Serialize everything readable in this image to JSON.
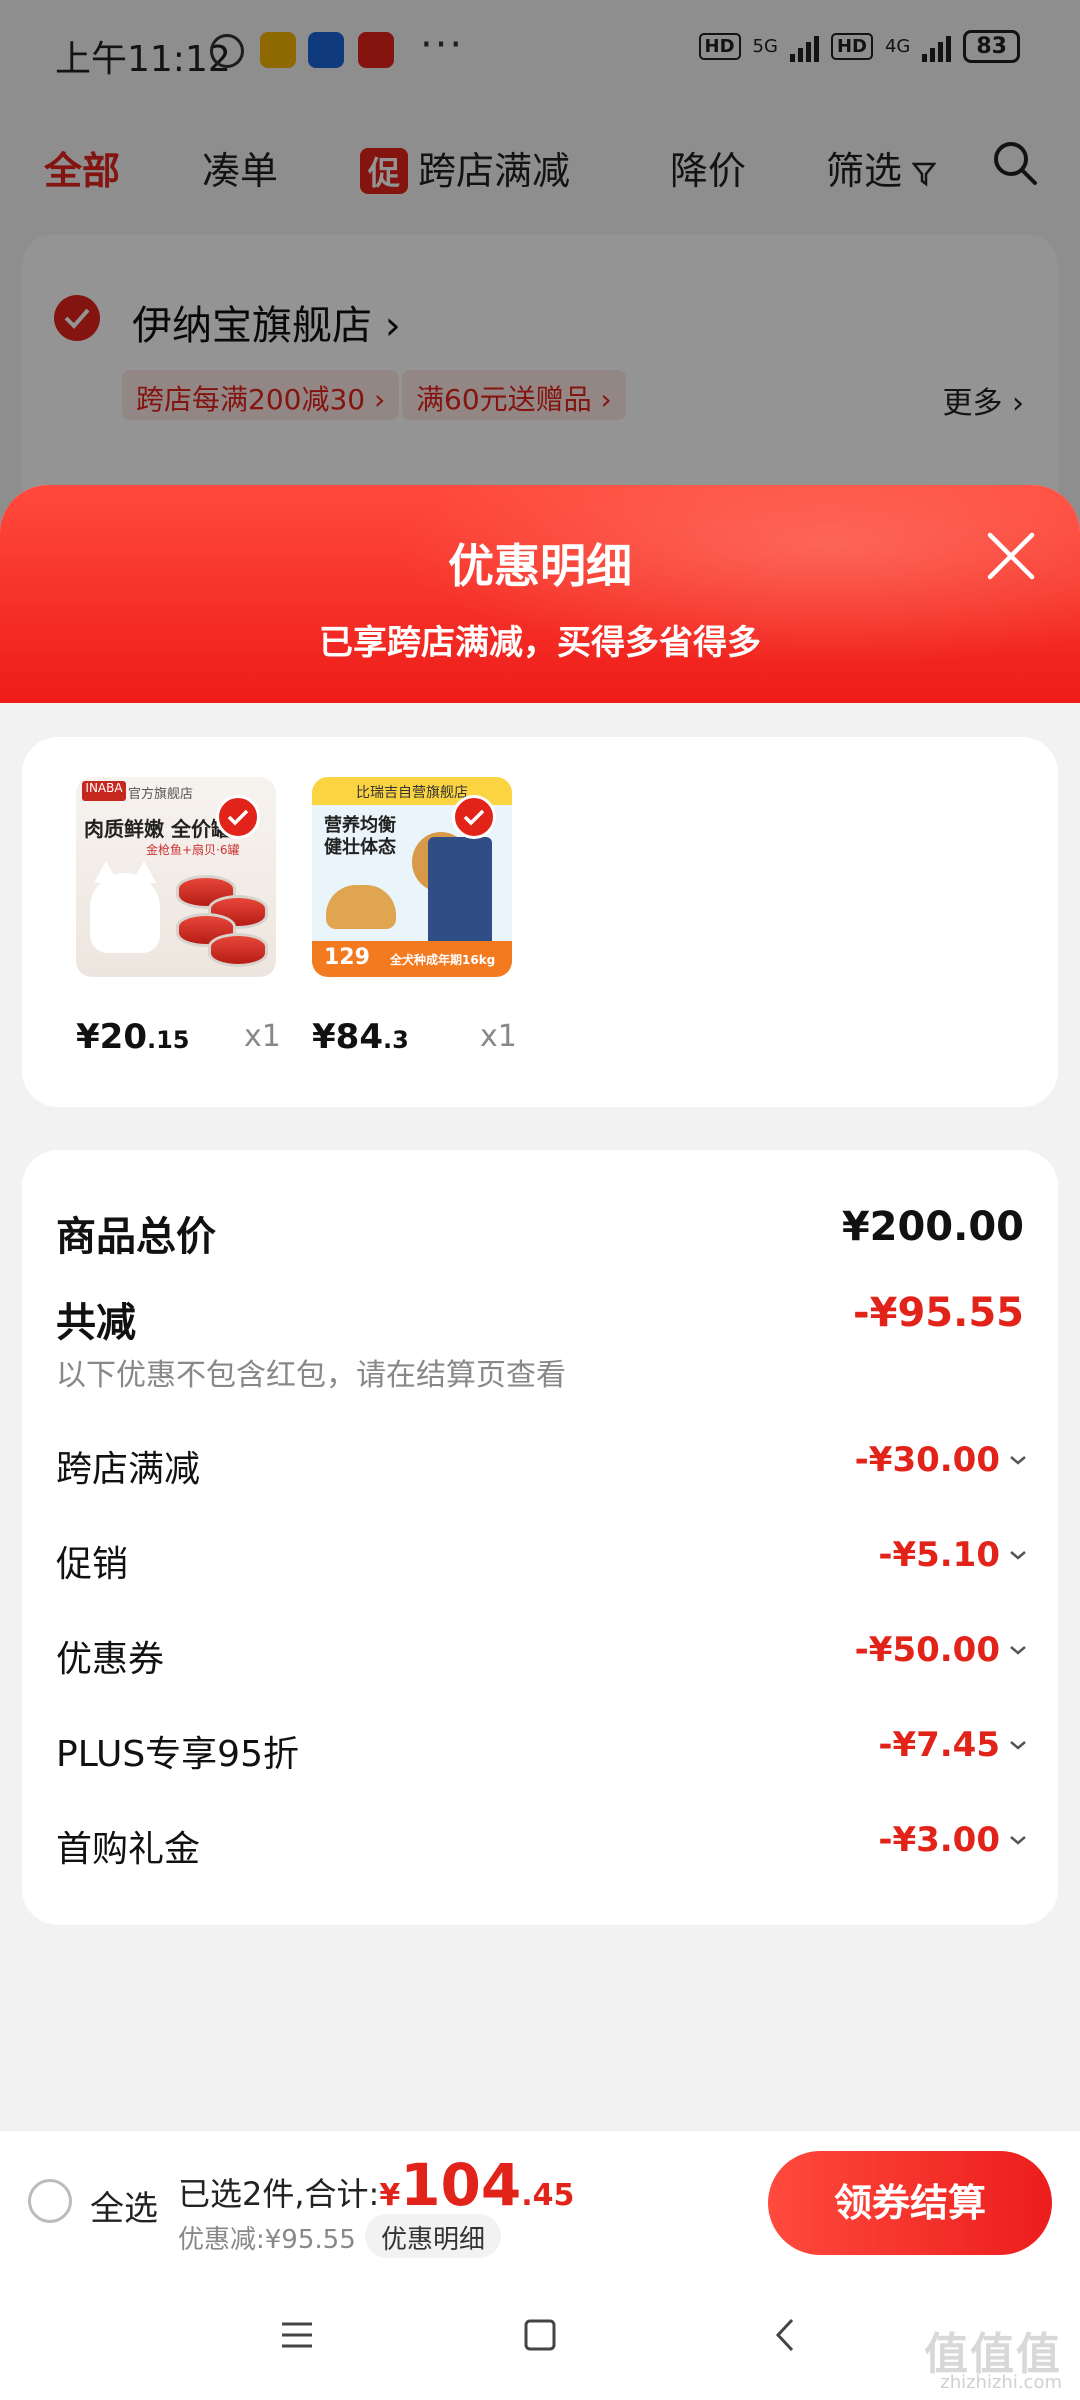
{
  "status_bar": {
    "time": "上午11:12",
    "network_hd_1": "HD",
    "network_5g": "5G",
    "network_hd_2": "HD",
    "network_4g": "4G",
    "battery": "83"
  },
  "filter_tabs": {
    "all": "全部",
    "bundle": "凑单",
    "cross_store_badge": "促",
    "cross_store": "跨店满减",
    "price_drop": "降价",
    "filter": "筛选"
  },
  "store": {
    "name": "伊纳宝旗舰店",
    "promo_1": "跨店每满200减30",
    "promo_2": "满60元送赠品",
    "more": "更多"
  },
  "sheet": {
    "title": "优惠明细",
    "subtitle": "已享跨店满减，买得多省得多"
  },
  "products": [
    {
      "store_tag": "官方旗舰店",
      "image_title": "肉质鲜嫩 全价罐",
      "image_sub": "金枪鱼+扇贝·6罐",
      "price_int": "¥20",
      "price_dec": ".15",
      "qty": "x1"
    },
    {
      "store_tag": "比瑞吉自营旗舰店",
      "image_title": "营养均衡 健壮体态",
      "image_price": "129",
      "image_spec": "全犬种成年期16kg",
      "price_int": "¥84",
      "price_dec": ".3",
      "qty": "x1"
    }
  ],
  "summary": {
    "total_label": "商品总价",
    "total_value": "¥200.00",
    "reduce_label": "共减",
    "reduce_value": "-¥95.55",
    "note": "以下优惠不包含红包，请在结算页查看",
    "items": [
      {
        "label": "跨店满减",
        "value": "-¥30.00"
      },
      {
        "label": "促销",
        "value": "-¥5.10"
      },
      {
        "label": "优惠券",
        "value": "-¥50.00"
      },
      {
        "label": "PLUS专享95折",
        "value": "-¥7.45"
      },
      {
        "label": "首购礼金",
        "value": "-¥3.00"
      }
    ]
  },
  "bottom_bar": {
    "select_all": "全选",
    "selected_text": "已选2件,合计:",
    "yen": "¥",
    "total_int": "104",
    "total_dec": ".45",
    "discount_text": "优惠减:¥95.55",
    "detail_chip": "优惠明细",
    "checkout": "领券结算"
  },
  "watermark": {
    "text": "值值值",
    "site": "zhizhizhi.com"
  },
  "colors": {
    "brand_red": "#e2231a",
    "sheet_header": "#ff4a3d"
  }
}
